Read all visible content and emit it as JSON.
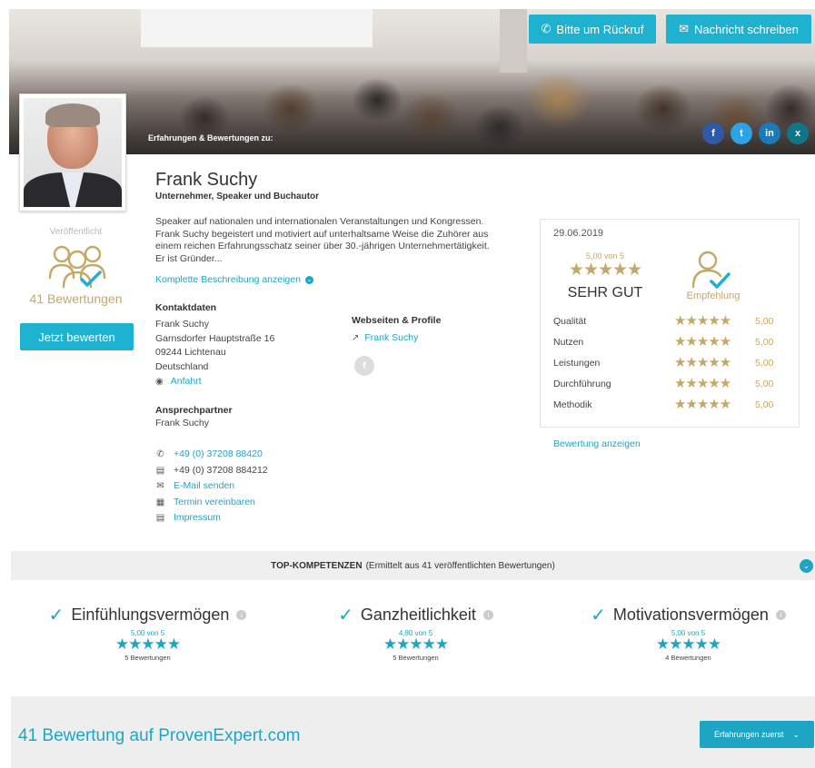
{
  "hero": {
    "caption": "Erfahrungen & Bewertungen zu:",
    "callback_label": "Bitte um Rückruf",
    "message_label": "Nachricht schreiben",
    "social": [
      "f",
      "t",
      "in",
      "x"
    ]
  },
  "profile": {
    "published": "Veröffentlicht",
    "reviews_count": "41 Bewertungen",
    "rate_button": "Jetzt bewerten",
    "name": "Frank Suchy",
    "subtitle": "Unternehmer, Speaker und Buchautor",
    "description_lines": [
      "Speaker auf nationalen und internationalen Veranstaltungen und Kongressen.",
      "Frank Suchy begeistert und motiviert auf unterhaltsame Weise die Zuhörer aus",
      "einem reichen Erfahrungsschatz seiner über 30.-jährigen Unternehmertätigkeit.",
      "Er ist Gründer..."
    ],
    "more_link": "Komplette Beschreibung anzeigen"
  },
  "contact": {
    "heading": "Kontaktdaten",
    "lines": [
      "Frank Suchy",
      "Garnsdorfer Hauptstraße 16",
      "09244 Lichtenau",
      "Deutschland"
    ],
    "route": "Anfahrt",
    "person_heading": "Ansprechpartner",
    "person_name": "Frank Suchy",
    "phone": "+49 (0) 37208 88420",
    "fax": "+49 (0) 37208 884212",
    "email": "E-Mail senden",
    "appointment": "Termin vereinbaren",
    "imprint": "Impressum"
  },
  "web": {
    "heading": "Webseiten & Profile",
    "link": "Frank Suchy",
    "fb": "f"
  },
  "rating": {
    "date": "29.06.2019",
    "score": "5,00 von 5",
    "stars": "★★★★★",
    "verdict": "SEHR GUT",
    "recommendation": "Empfehlung",
    "criteria": [
      {
        "label": "Qualität",
        "stars": "★★★★★",
        "value": "5,00"
      },
      {
        "label": "Nutzen",
        "stars": "★★★★★",
        "value": "5,00"
      },
      {
        "label": "Leistungen",
        "stars": "★★★★★",
        "value": "5,00"
      },
      {
        "label": "Durchführung",
        "stars": "★★★★★",
        "value": "5,00"
      },
      {
        "label": "Methodik",
        "stars": "★★★★★",
        "value": "5,00"
      }
    ],
    "show_link": "Bewertung anzeigen"
  },
  "competences": {
    "heading_bold": "TOP-KOMPETENZEN",
    "heading_rest": "(Ermittelt aus 41 veröffentlichten Bewertungen)",
    "items": [
      {
        "title": "Einfühlungsvermögen",
        "score": "5,00 von 5",
        "stars": "★★★★★",
        "count": "5 Bewertungen"
      },
      {
        "title": "Ganzheitlichkeit",
        "score": "4,80 von 5",
        "stars": "★★★★★",
        "count": "5 Bewertungen"
      },
      {
        "title": "Motivationsvermögen",
        "score": "5,00 von 5",
        "stars": "★★★★★",
        "count": "4 Bewertungen"
      }
    ]
  },
  "footer": {
    "title": "41 Bewertung auf ProvenExpert.com",
    "sort_label": "Erfahrungen zuerst"
  },
  "colors": {
    "accent": "#1fb2d0",
    "gold": "#c5a865"
  }
}
